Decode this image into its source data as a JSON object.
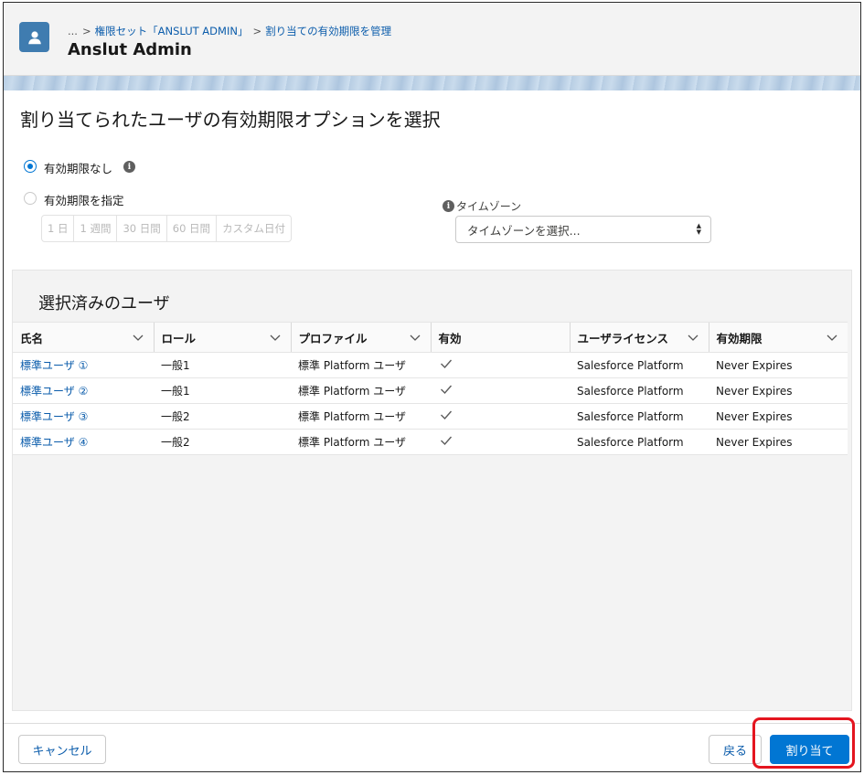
{
  "header": {
    "breadcrumb": {
      "ellipsis": "...",
      "item1": "権限セット「ANSLUT ADMIN」",
      "item2": "割り当ての有効期限を管理"
    },
    "title": "Anslut Admin"
  },
  "main": {
    "heading": "割り当てられたユーザの有効期限オプションを選択",
    "option_no_expiry": "有効期限なし",
    "option_set_expiry": "有効期限を指定",
    "durations": [
      "1 日",
      "1 週間",
      "30 日間",
      "60 日間",
      "カスタム日付"
    ],
    "timezone": {
      "label": "タイムゾーン",
      "placeholder": "タイムゾーンを選択..."
    }
  },
  "users_panel": {
    "title": "選択済みのユーザ",
    "columns": [
      "氏名",
      "ロール",
      "プロファイル",
      "有効",
      "ユーザライセンス",
      "有効期限"
    ],
    "rows": [
      {
        "name": "標準ユーザ ①",
        "role": "一般1",
        "profile": "標準 Platform ユーザ",
        "active": "✓",
        "license": "Salesforce Platform",
        "expiry": "Never Expires"
      },
      {
        "name": "標準ユーザ ②",
        "role": "一般1",
        "profile": "標準 Platform ユーザ",
        "active": "✓",
        "license": "Salesforce Platform",
        "expiry": "Never Expires"
      },
      {
        "name": "標準ユーザ ③",
        "role": "一般2",
        "profile": "標準 Platform ユーザ",
        "active": "✓",
        "license": "Salesforce Platform",
        "expiry": "Never Expires"
      },
      {
        "name": "標準ユーザ ④",
        "role": "一般2",
        "profile": "標準 Platform ユーザ",
        "active": "✓",
        "license": "Salesforce Platform",
        "expiry": "Never Expires"
      }
    ]
  },
  "footer": {
    "cancel": "キャンセル",
    "back": "戻る",
    "assign": "割り当て"
  },
  "colors": {
    "brand": "#0176d3",
    "link": "#0b5cab",
    "highlight": "#e4151f",
    "avatar": "#3f7cb0"
  },
  "icons": {
    "avatar": "user-icon",
    "info": "info-icon",
    "sort": "chevron-down-icon",
    "select": "updown-arrows-icon",
    "check": "check-icon"
  }
}
